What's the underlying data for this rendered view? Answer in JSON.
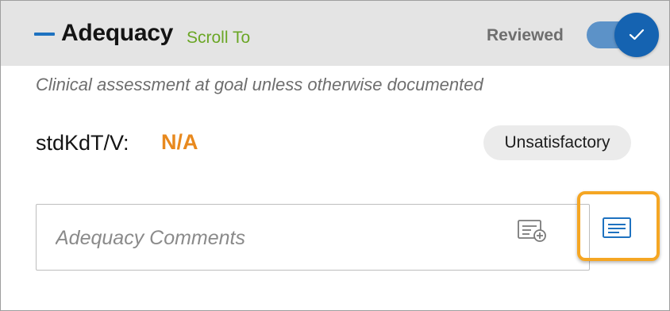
{
  "section": {
    "title": "Adequacy",
    "scroll_to_label": "Scroll To",
    "reviewed_label": "Reviewed",
    "reviewed": true,
    "subtitle": "Clinical assessment at goal unless otherwise documented"
  },
  "metric": {
    "label": "stdKdT/V:",
    "value": "N/A",
    "status": "Unsatisfactory"
  },
  "comments": {
    "placeholder": "Adequacy Comments",
    "value": ""
  },
  "icons": {
    "collapse": "minus-icon",
    "reviewed_toggle": "check-icon",
    "add_comment": "add-note-icon",
    "comment_template": "note-lines-icon"
  },
  "colors": {
    "header_bg": "#e4e4e4",
    "accent_blue": "#1563b1",
    "link_green": "#6aa625",
    "value_orange": "#e8891e",
    "highlight_orange": "#f5a623"
  }
}
